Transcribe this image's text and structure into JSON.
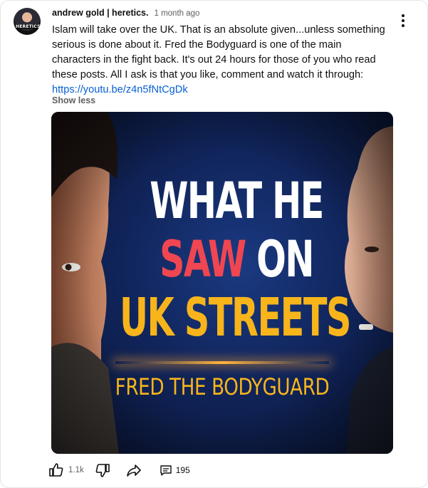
{
  "post": {
    "author": "andrew gold | heretics.",
    "time": "1 month ago",
    "avatar_badge": "HERETICS",
    "text": "Islam will take over the UK. That is an absolute given...unless something serious is done about it. Fred the Bodyguard is one of the main characters in the fight back. It's out 24 hours for those of you who read these posts. All I ask is that you like, comment and watch it through: ",
    "link": "https://youtu.be/z4n5fNtCgDk",
    "show_less": "Show less",
    "menu_icon": "more-vert-icon"
  },
  "thumbnail": {
    "line1": "WHAT HE",
    "line2_red": "SAW",
    "line2_white": "ON",
    "line3": "UK STREETS",
    "subline": "FRED THE BODYGUARD",
    "colors": {
      "white": "#ffffff",
      "red": "#f04651",
      "gold": "#f7b51b",
      "bg": "#10245a"
    }
  },
  "actions": {
    "like_icon": "thumbs-up-icon",
    "like_count": "1.1k",
    "dislike_icon": "thumbs-down-icon",
    "share_icon": "share-icon",
    "comment_icon": "comment-icon",
    "comment_count": "195"
  }
}
